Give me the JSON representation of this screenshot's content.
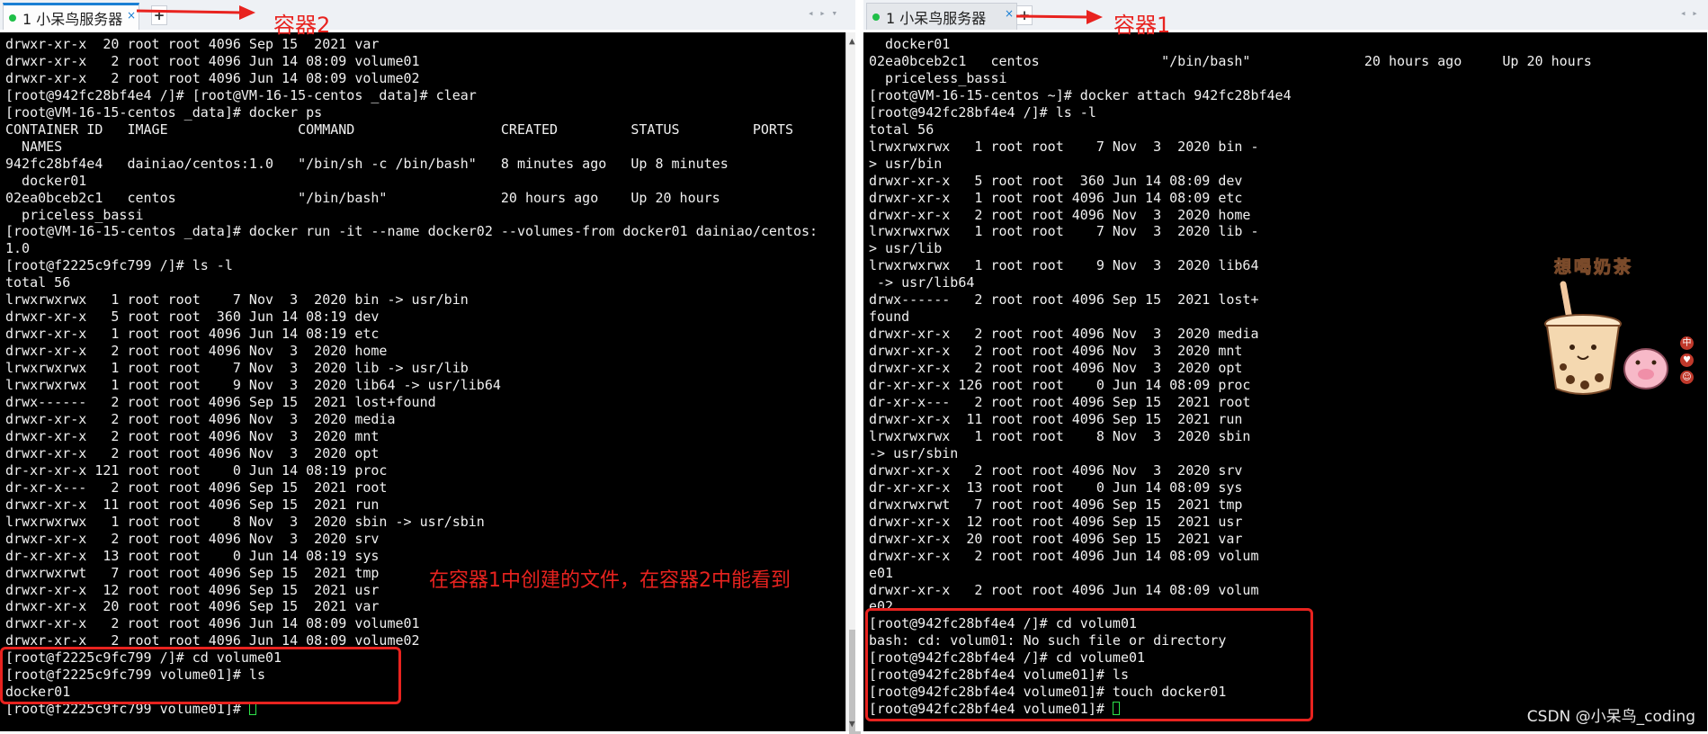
{
  "left_window": {
    "tab_label": "1 小呆鸟服务器",
    "tab_close": "×",
    "add_tab": "+",
    "nav": "◂ ▸ ▾",
    "annotation_label": "容器2",
    "terminal_lines": [
      "drwxr-xr-x  20 root root 4096 Sep 15  2021 var",
      "drwxr-xr-x   2 root root 4096 Jun 14 08:09 volume01",
      "drwxr-xr-x   2 root root 4096 Jun 14 08:09 volume02",
      "[root@942fc28bf4e4 /]# [root@VM-16-15-centos _data]# clear",
      "[root@VM-16-15-centos _data]# docker ps",
      "CONTAINER ID   IMAGE                COMMAND                  CREATED         STATUS         PORTS",
      "  NAMES",
      "942fc28bf4e4   dainiao/centos:1.0   \"/bin/sh -c /bin/bash\"   8 minutes ago   Up 8 minutes",
      "  docker01",
      "02ea0bceb2c1   centos               \"/bin/bash\"              20 hours ago    Up 20 hours",
      "  priceless_bassi",
      "[root@VM-16-15-centos _data]# docker run -it --name docker02 --volumes-from docker01 dainiao/centos:",
      "1.0",
      "[root@f2225c9fc799 /]# ls -l",
      "total 56",
      "lrwxrwxrwx   1 root root    7 Nov  3  2020 bin -> usr/bin",
      "drwxr-xr-x   5 root root  360 Jun 14 08:19 dev",
      "drwxr-xr-x   1 root root 4096 Jun 14 08:19 etc",
      "drwxr-xr-x   2 root root 4096 Nov  3  2020 home",
      "lrwxrwxrwx   1 root root    7 Nov  3  2020 lib -> usr/lib",
      "lrwxrwxrwx   1 root root    9 Nov  3  2020 lib64 -> usr/lib64",
      "drwx------   2 root root 4096 Sep 15  2021 lost+found",
      "drwxr-xr-x   2 root root 4096 Nov  3  2020 media",
      "drwxr-xr-x   2 root root 4096 Nov  3  2020 mnt",
      "drwxr-xr-x   2 root root 4096 Nov  3  2020 opt",
      "dr-xr-xr-x 121 root root    0 Jun 14 08:19 proc",
      "dr-xr-x---   2 root root 4096 Sep 15  2021 root",
      "drwxr-xr-x  11 root root 4096 Sep 15  2021 run",
      "lrwxrwxrwx   1 root root    8 Nov  3  2020 sbin -> usr/sbin",
      "drwxr-xr-x   2 root root 4096 Nov  3  2020 srv",
      "dr-xr-xr-x  13 root root    0 Jun 14 08:19 sys",
      "drwxrwxrwt   7 root root 4096 Sep 15  2021 tmp",
      "drwxr-xr-x  12 root root 4096 Sep 15  2021 usr",
      "drwxr-xr-x  20 root root 4096 Sep 15  2021 var",
      "drwxr-xr-x   2 root root 4096 Jun 14 08:09 volume01",
      "drwxr-xr-x   2 root root 4096 Jun 14 08:09 volume02",
      "[root@f2225c9fc799 /]# cd volume01",
      "[root@f2225c9fc799 volume01]# ls",
      "docker01",
      "[root@f2225c9fc799 volume01]# "
    ]
  },
  "right_window": {
    "tab_label": "1 小呆鸟服务器",
    "tab_close": "×",
    "add_tab": "+",
    "nav": "◂ ▸",
    "annotation_label": "容器1",
    "terminal_lines": [
      "  docker01",
      "02ea0bceb2c1   centos               \"/bin/bash\"              20 hours ago     Up 20 hours",
      "  priceless_bassi",
      "[root@VM-16-15-centos ~]# docker attach 942fc28bf4e4",
      "[root@942fc28bf4e4 /]# ls -l",
      "total 56",
      "lrwxrwxrwx   1 root root    7 Nov  3  2020 bin -",
      "> usr/bin",
      "drwxr-xr-x   5 root root  360 Jun 14 08:09 dev",
      "drwxr-xr-x   1 root root 4096 Jun 14 08:09 etc",
      "drwxr-xr-x   2 root root 4096 Nov  3  2020 home",
      "lrwxrwxrwx   1 root root    7 Nov  3  2020 lib -",
      "> usr/lib",
      "lrwxrwxrwx   1 root root    9 Nov  3  2020 lib64",
      " -> usr/lib64",
      "drwx------   2 root root 4096 Sep 15  2021 lost+",
      "found",
      "drwxr-xr-x   2 root root 4096 Nov  3  2020 media",
      "drwxr-xr-x   2 root root 4096 Nov  3  2020 mnt",
      "drwxr-xr-x   2 root root 4096 Nov  3  2020 opt",
      "dr-xr-xr-x 126 root root    0 Jun 14 08:09 proc",
      "dr-xr-x---   2 root root 4096 Sep 15  2021 root",
      "drwxr-xr-x  11 root root 4096 Sep 15  2021 run",
      "lrwxrwxrwx   1 root root    8 Nov  3  2020 sbin",
      "-> usr/sbin",
      "drwxr-xr-x   2 root root 4096 Nov  3  2020 srv",
      "dr-xr-xr-x  13 root root    0 Jun 14 08:09 sys",
      "drwxrwxrwt   7 root root 4096 Sep 15  2021 tmp",
      "drwxr-xr-x  12 root root 4096 Sep 15  2021 usr",
      "drwxr-xr-x  20 root root 4096 Sep 15  2021 var",
      "drwxr-xr-x   2 root root 4096 Jun 14 08:09 volum",
      "e01",
      "drwxr-xr-x   2 root root 4096 Jun 14 08:09 volum",
      "e02",
      "[root@942fc28bf4e4 /]# cd volum01",
      "bash: cd: volum01: No such file or directory",
      "[root@942fc28bf4e4 /]# cd volume01",
      "[root@942fc28bf4e4 volume01]# ls",
      "[root@942fc28bf4e4 volume01]# touch docker01",
      "[root@942fc28bf4e4 volume01]# "
    ]
  },
  "annotation_center": "在容器1中创建的文件，在容器2中能看到",
  "sticker": {
    "text": "想喝奶茶",
    "badges": [
      "中",
      "♥",
      "☺"
    ]
  },
  "watermark": "CSDN @小呆鸟_coding",
  "colors": {
    "terminal_bg": "#000000",
    "terminal_fg": "#f0f0f0",
    "annotation": "#e8231f",
    "cursor": "#2ee34a",
    "tab_active": "#1a7fd4"
  }
}
